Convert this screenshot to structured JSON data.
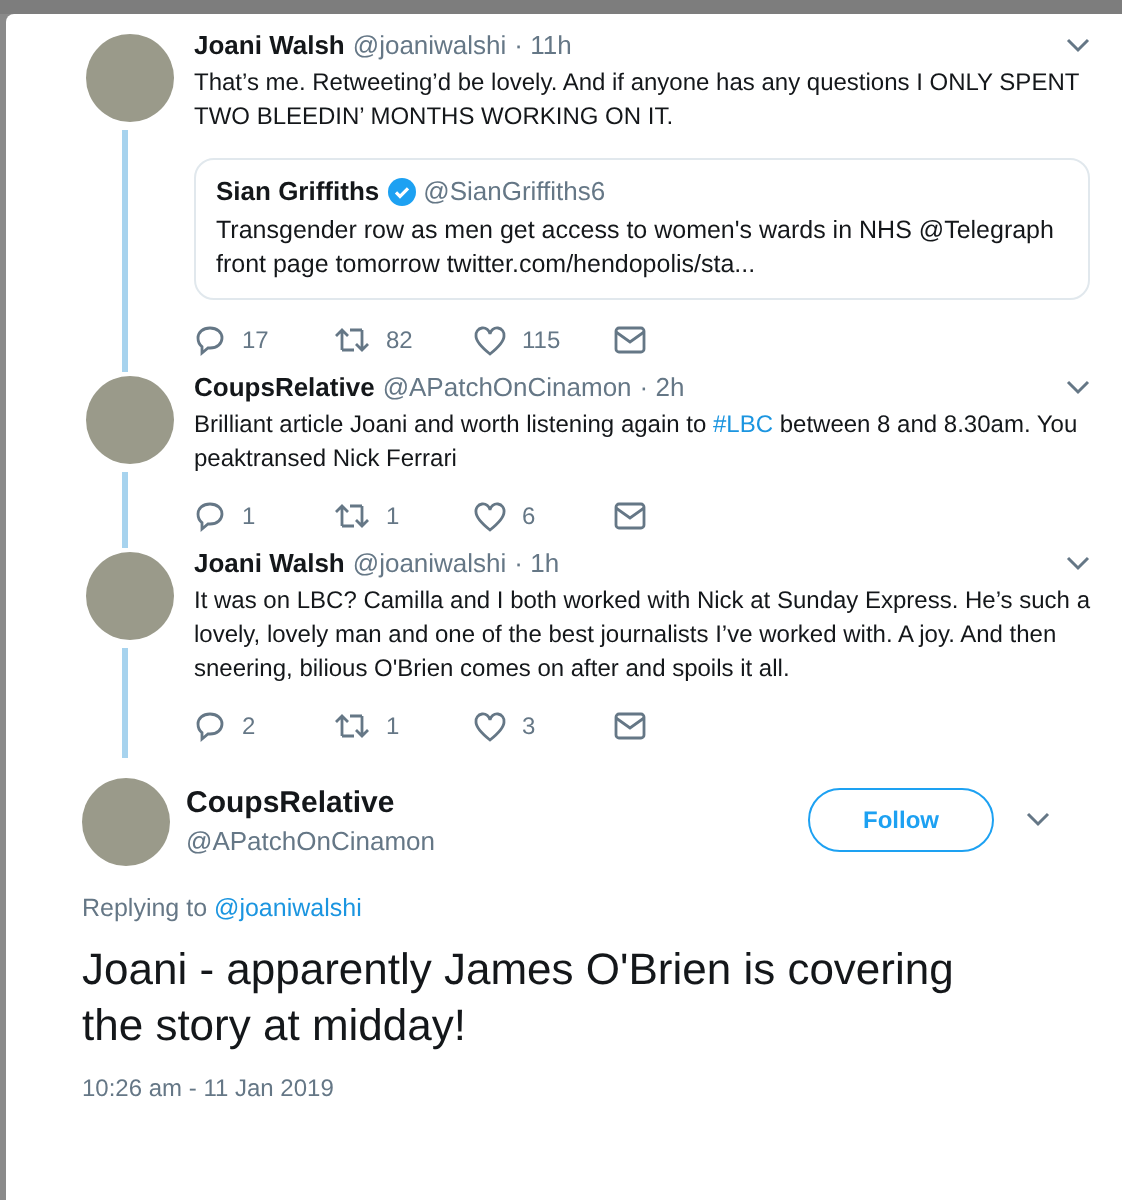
{
  "thread": [
    {
      "name": "Joani Walsh",
      "handle": "@joaniwalshi",
      "time": "· 11h",
      "body": [
        {
          "kind": "text",
          "text": "That’s me. Retweeting’d be lovely. And if anyone has any questions I ONLY SPENT TWO BLEEDIN’ MONTHS WORKING ON IT."
        }
      ],
      "quote": {
        "name": "Sian Griffiths",
        "handle": "@SianGriffiths6",
        "text": "Transgender row as men get access to women's wards in NHS @Telegraph front page tomorrow twitter.com/hendopolis/sta..."
      },
      "replies": "17",
      "retweets": "82",
      "likes": "115"
    },
    {
      "name": "CoupsRelative",
      "handle": "@APatchOnCinamon",
      "time": "· 2h",
      "body": [
        {
          "kind": "text",
          "text": "Brilliant article Joani and worth listening again to "
        },
        {
          "kind": "link",
          "text": "#LBC"
        },
        {
          "kind": "text",
          "text": " between 8 and 8.30am. You peaktransed Nick Ferrari"
        }
      ],
      "replies": "1",
      "retweets": "1",
      "likes": "6"
    },
    {
      "name": "Joani Walsh",
      "handle": "@joaniwalshi",
      "time": "· 1h",
      "body": [
        {
          "kind": "text",
          "text": "It was on LBC? Camilla and I both worked with Nick at Sunday Express. He’s such a lovely, lovely man and one of the best journalists I’ve worked with. A joy. And then sneering, bilious O'Brien comes on after and spoils it all."
        }
      ],
      "replies": "2",
      "retweets": "1",
      "likes": "3"
    }
  ],
  "main_tweet": {
    "name": "CoupsRelative",
    "handle": "@APatchOnCinamon",
    "follow_label": "Follow",
    "replying_prefix": "Replying to",
    "replying_to": "@joaniwalshi",
    "text": "Joani - apparently James O'Brien is covering the story at midday!",
    "timestamp": "10:26 am - 11 Jan 2019"
  }
}
